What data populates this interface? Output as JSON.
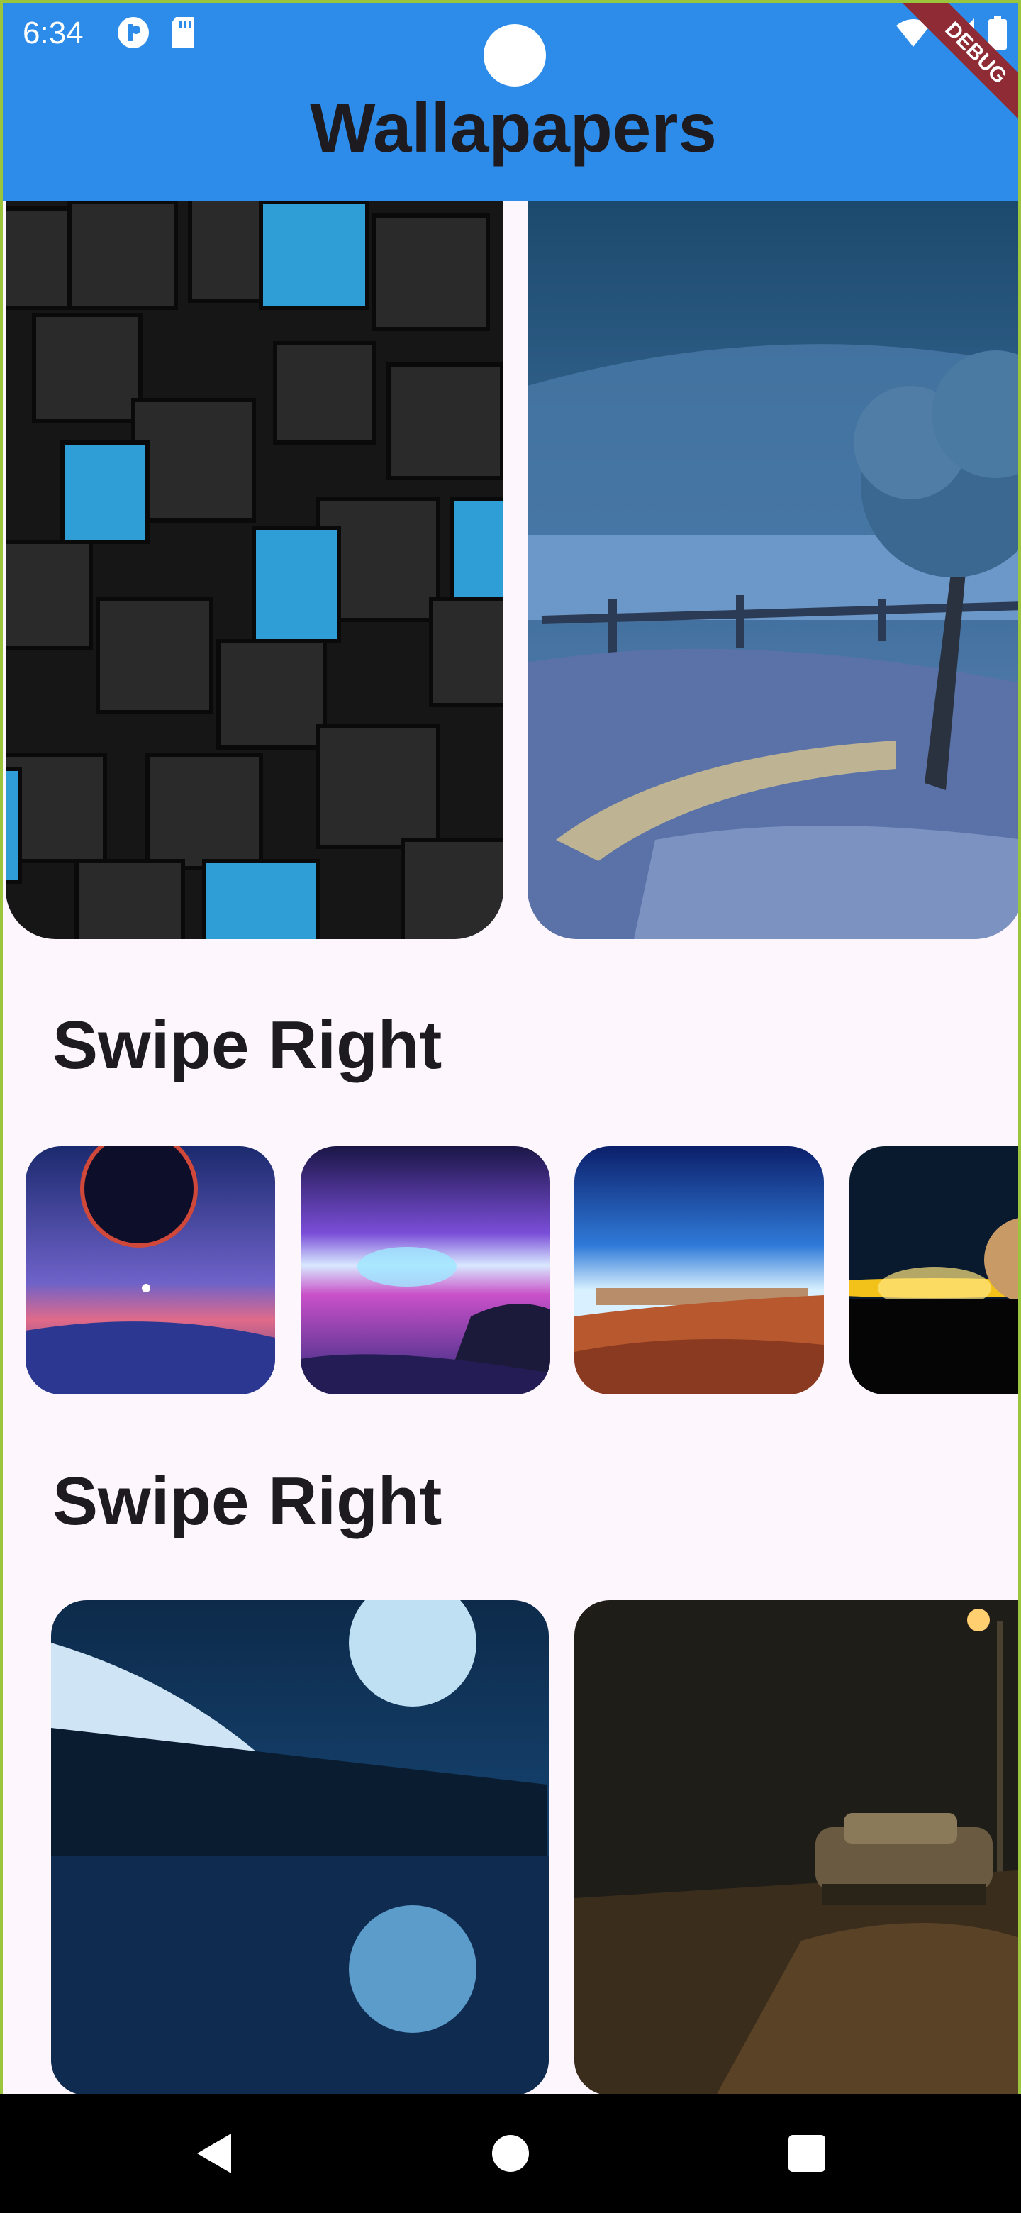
{
  "status_bar": {
    "time": "6:34",
    "left_icons": [
      "cast-app-icon",
      "sd-card-icon"
    ],
    "right_icons": [
      "wifi-icon",
      "signal-icon",
      "battery-icon"
    ]
  },
  "app_bar": {
    "title": "Wallapapers",
    "debug_banner": "DEBUG",
    "color": "#2d8ce9"
  },
  "sections": [
    {
      "heading": "",
      "tiles": [
        "wallpaper-black-blue-cubes",
        "wallpaper-moonlit-field-tree"
      ]
    },
    {
      "heading": "Swipe Right",
      "tiles": [
        "wallpaper-planet-ocean",
        "wallpaper-neon-horizon",
        "wallpaper-desert-sky",
        "wallpaper-space-sunrise"
      ]
    },
    {
      "heading": "Swipe Right",
      "tiles": [
        "wallpaper-moon-lake",
        "wallpaper-car-night-street"
      ]
    }
  ],
  "nav_bar": {
    "buttons": [
      "back-icon",
      "home-icon",
      "recents-icon"
    ]
  }
}
